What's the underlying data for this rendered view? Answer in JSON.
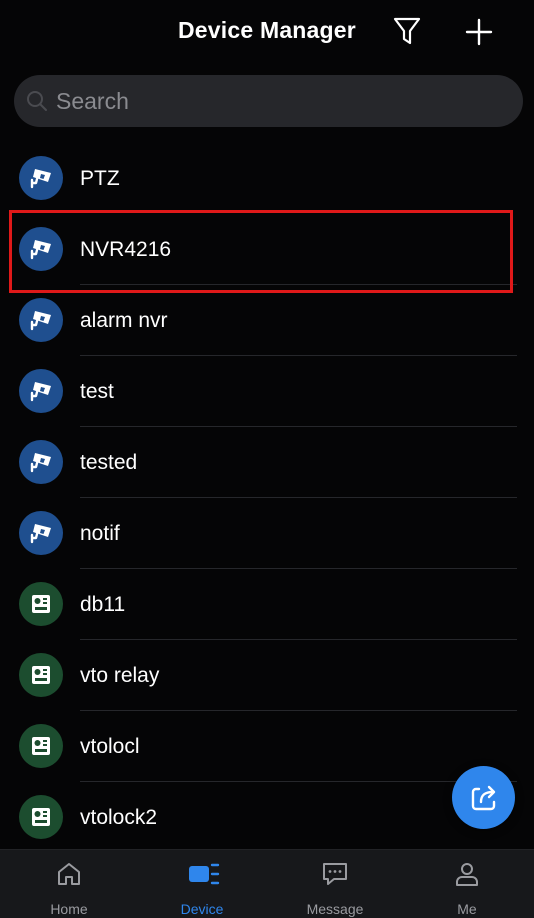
{
  "header": {
    "title": "Device Manager",
    "filter_icon": "filter-icon",
    "add_icon": "plus-icon"
  },
  "search": {
    "placeholder": "Search",
    "value": ""
  },
  "devices": [
    {
      "name": "PTZ",
      "type": "camera",
      "icon": "security-camera-icon"
    },
    {
      "name": "NVR4216",
      "type": "camera",
      "icon": "security-camera-icon",
      "highlighted": true
    },
    {
      "name": "alarm nvr",
      "type": "camera",
      "icon": "security-camera-icon"
    },
    {
      "name": "test",
      "type": "camera",
      "icon": "security-camera-icon"
    },
    {
      "name": "tested",
      "type": "camera",
      "icon": "security-camera-icon"
    },
    {
      "name": "notif",
      "type": "camera",
      "icon": "security-camera-icon"
    },
    {
      "name": "db11",
      "type": "intercom",
      "icon": "door-station-icon"
    },
    {
      "name": "vto relay",
      "type": "intercom",
      "icon": "door-station-icon"
    },
    {
      "name": "vtolocl",
      "type": "intercom",
      "icon": "door-station-icon"
    },
    {
      "name": "vtolock2",
      "type": "intercom",
      "icon": "door-station-icon"
    }
  ],
  "fab": {
    "icon": "share-icon"
  },
  "bottom_nav": {
    "items": [
      {
        "label": "Home",
        "icon": "home-icon",
        "active": false
      },
      {
        "label": "Device",
        "icon": "device-icon",
        "active": true
      },
      {
        "label": "Message",
        "icon": "message-icon",
        "active": false
      },
      {
        "label": "Me",
        "icon": "person-icon",
        "active": false
      }
    ]
  },
  "colors": {
    "background": "#050506",
    "accent": "#2f86ec",
    "camera_avatar": "#1f4f8f",
    "intercom_avatar": "#1c4d2f",
    "highlight": "#e01919"
  }
}
